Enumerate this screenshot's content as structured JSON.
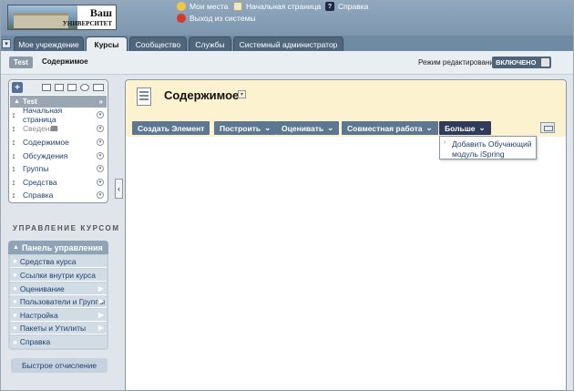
{
  "logo": {
    "line1": "Ваш",
    "line2": "УНИВЕРСИТЕТ"
  },
  "top_links": [
    {
      "label": "Мои места",
      "icon": "person-icon"
    },
    {
      "label": "Начальная страница",
      "icon": "home-icon"
    },
    {
      "label": "Справка",
      "icon": "help-icon"
    },
    {
      "label": "Выход из системы",
      "icon": "logout-icon"
    }
  ],
  "tabs": [
    {
      "label": "Мое учреждение",
      "active": false
    },
    {
      "label": "Курсы",
      "active": true
    },
    {
      "label": "Сообщество",
      "active": false
    },
    {
      "label": "Службы",
      "active": false
    },
    {
      "label": "Системный администратор",
      "active": false
    }
  ],
  "breadcrumb": {
    "course": "Test",
    "page": "Содержимое"
  },
  "edit_mode": {
    "label": "Режим редактирования:",
    "state": "ВКЛЮЧЕНО"
  },
  "course_menu": {
    "title": "Test",
    "items": [
      {
        "label": "Начальная страница",
        "hidden": false
      },
      {
        "label": "Сведения",
        "hidden": true
      },
      {
        "label": "Содержимое",
        "hidden": false
      },
      {
        "label": "Обсуждения",
        "hidden": false
      },
      {
        "label": "Группы",
        "hidden": false
      },
      {
        "label": "Средства",
        "hidden": false
      },
      {
        "label": "Справка",
        "hidden": false
      }
    ]
  },
  "control_panel": {
    "heading": "УПРАВЛЕНИЕ КУРСОМ",
    "title": "Панель управления",
    "items": [
      {
        "label": "Средства курса",
        "more": false
      },
      {
        "label": "Ссылки внутри курса",
        "more": false
      },
      {
        "label": "Оценивание",
        "more": true
      },
      {
        "label": "Пользователи и Группы",
        "more": true
      },
      {
        "label": "Настройка",
        "more": true
      },
      {
        "label": "Пакеты и Утилиты",
        "more": true
      },
      {
        "label": "Справка",
        "more": false
      }
    ],
    "quick_button": "Быстрое отчисление"
  },
  "content": {
    "title": "Содержимое",
    "actions": [
      {
        "label": "Создать Элемент",
        "dropdown": false
      },
      {
        "label": "Построить",
        "dropdown": true
      },
      {
        "label": "Оценивать",
        "dropdown": true
      },
      {
        "label": "Совместная работа",
        "dropdown": true
      },
      {
        "label": "Больше",
        "dropdown": true
      }
    ],
    "menu_item": "Добавить Обучающий модуль iSpring"
  },
  "colors": {
    "action_button": "#5d7790",
    "action_button_active": "#2f3b57",
    "header_bg": "#fdf2cf"
  }
}
